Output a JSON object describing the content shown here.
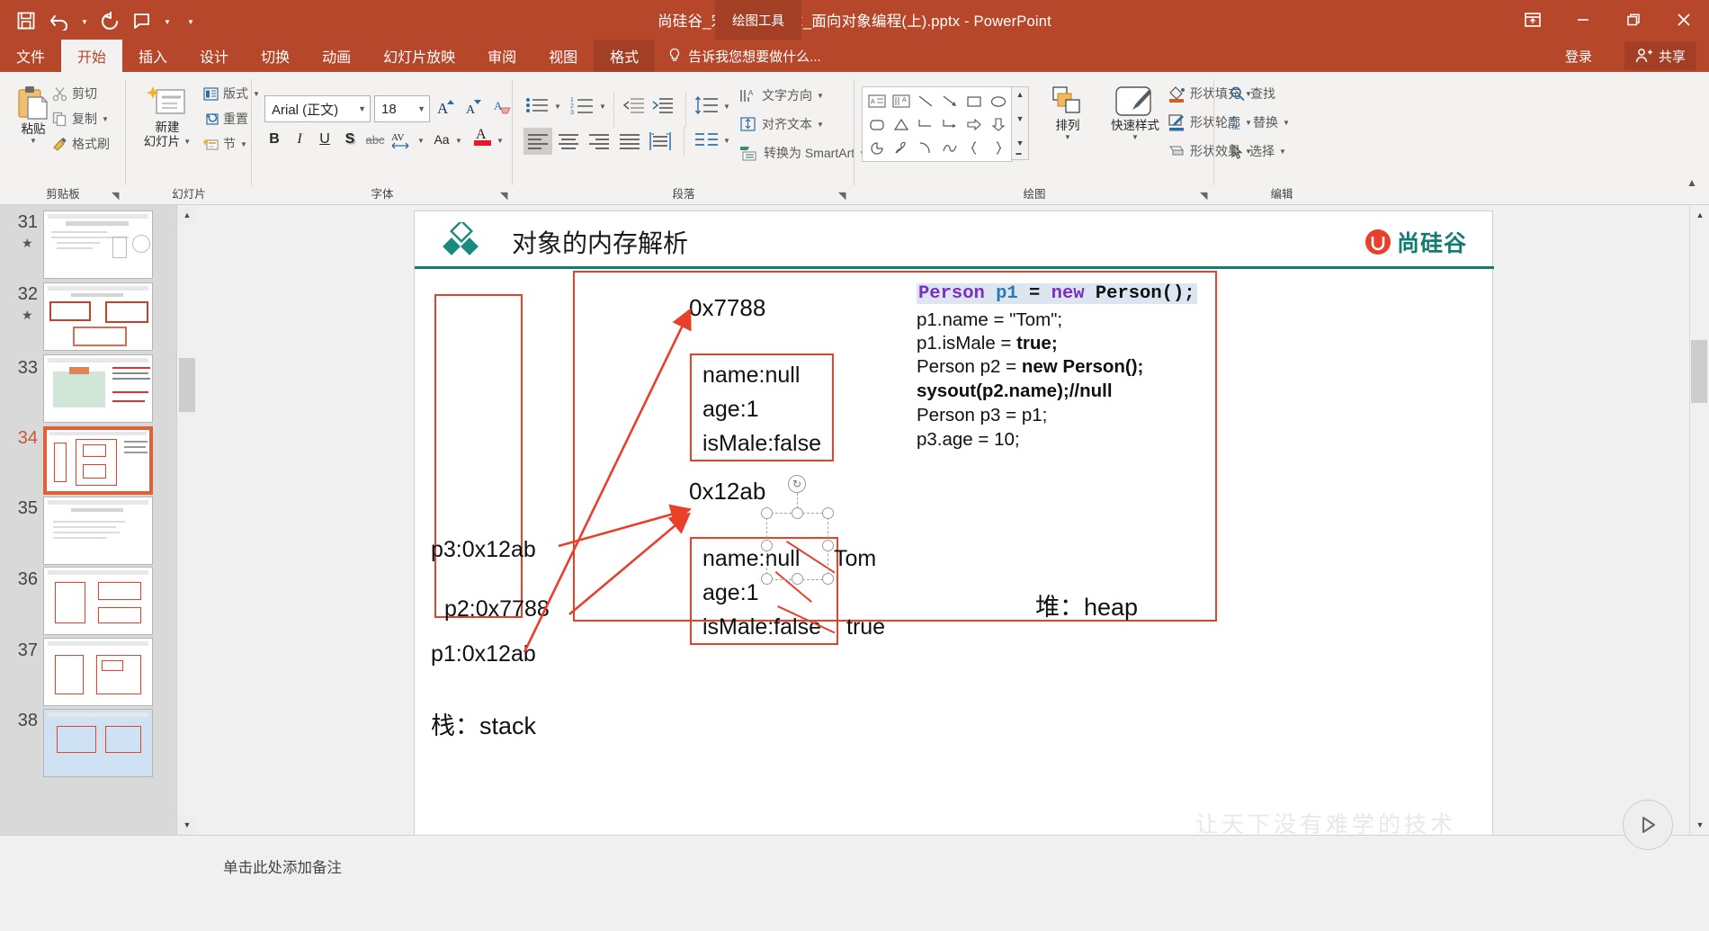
{
  "window": {
    "title": "尚硅谷_宋红康_第4章_面向对象编程(上).pptx - PowerPoint",
    "contextual_tab_group": "绘图工具",
    "signin": "登录",
    "share": "共享",
    "ribbon_display_icon": "ribbon-display-options-icon",
    "minimize_icon": "minimize-icon",
    "restore_icon": "restore-icon",
    "close_icon": "close-icon"
  },
  "qat": {
    "save": "save-icon",
    "undo": "undo-icon",
    "redo": "redo-icon",
    "start_from_beginning": "presentation-icon",
    "customize": "customize-qat-icon"
  },
  "tabs": [
    {
      "label": "文件",
      "active": false,
      "ctx": false
    },
    {
      "label": "开始",
      "active": true,
      "ctx": false
    },
    {
      "label": "插入",
      "active": false,
      "ctx": false
    },
    {
      "label": "设计",
      "active": false,
      "ctx": false
    },
    {
      "label": "切换",
      "active": false,
      "ctx": false
    },
    {
      "label": "动画",
      "active": false,
      "ctx": false
    },
    {
      "label": "幻灯片放映",
      "active": false,
      "ctx": false
    },
    {
      "label": "审阅",
      "active": false,
      "ctx": false
    },
    {
      "label": "视图",
      "active": false,
      "ctx": false
    },
    {
      "label": "格式",
      "active": false,
      "ctx": true
    }
  ],
  "tell_me": "告诉我您想要做什么...",
  "ribbon": {
    "groups": [
      {
        "label": "剪贴板"
      },
      {
        "label": "幻灯片"
      },
      {
        "label": "字体"
      },
      {
        "label": "段落"
      },
      {
        "label": "绘图"
      },
      {
        "label": "编辑"
      }
    ],
    "clipboard": {
      "paste": "粘贴",
      "cut": "剪切",
      "copy": "复制",
      "format_painter": "格式刷"
    },
    "slides": {
      "new_slide": "新建\n幻灯片",
      "new_slide_line1": "新建",
      "new_slide_line2": "幻灯片",
      "layout": "版式",
      "reset": "重置",
      "section": "节"
    },
    "font": {
      "font_name": "Arial (正文)",
      "font_size": "18",
      "bold": "B",
      "italic": "I",
      "underline": "U",
      "shadow": "S",
      "strikethrough": "abc",
      "char_spacing": "AV",
      "change_case": "Aa",
      "font_color": "A",
      "increase_size": "A",
      "decrease_size": "A",
      "clear_formatting": "clear-formatting-icon"
    },
    "paragraph": {
      "bullets": "bullets-icon",
      "numbering": "numbering-icon",
      "decrease_indent": "decrease-indent-icon",
      "increase_indent": "increase-indent-icon",
      "line_spacing": "line-spacing-icon",
      "align_left": "align-left-icon",
      "align_center": "align-center-icon",
      "align_right": "align-right-icon",
      "justify": "justify-icon",
      "columns": "columns-icon",
      "text_direction": "文字方向",
      "align_text": "对齐文本",
      "convert_smartart": "转换为 SmartArt"
    },
    "drawing": {
      "arrange": "排列",
      "quick_styles": "快速样式",
      "shape_fill": "形状填充",
      "shape_outline": "形状轮廓",
      "shape_effects": "形状效果"
    },
    "editing": {
      "find": "查找",
      "replace": "替换",
      "select": "选择"
    }
  },
  "thumbnails": [
    {
      "num": "31",
      "star": true,
      "selected": false
    },
    {
      "num": "32",
      "star": true,
      "selected": false
    },
    {
      "num": "33",
      "star": false,
      "selected": false
    },
    {
      "num": "34",
      "star": false,
      "selected": true
    },
    {
      "num": "35",
      "star": false,
      "selected": false
    },
    {
      "num": "36",
      "star": false,
      "selected": false
    },
    {
      "num": "37",
      "star": false,
      "selected": false
    },
    {
      "num": "38",
      "star": false,
      "selected": false
    }
  ],
  "slide": {
    "title": "对象的内存解析",
    "brand": "尚硅谷",
    "watermark": "让天下没有难学的技术",
    "stack_label": "栈：stack",
    "heap_label": "堆：heap",
    "stack_entries": [
      "p3:0x12ab",
      "p2:0x7788",
      "p1:0x12ab"
    ],
    "object1": {
      "address": "0x7788",
      "fields": [
        "name:null",
        "age:1",
        "isMale:false"
      ]
    },
    "object2": {
      "address": "0x12ab",
      "fields": [
        "name:null",
        "age:1",
        "isMale:false"
      ],
      "annotations": [
        "Tom",
        "true"
      ]
    },
    "code": [
      "Person p1 = new Person();",
      "p1.name = \"Tom\";",
      "p1.isMale = true;",
      "Person p2 = new Person();",
      "sysout(p2.name);//null",
      "Person p3 = p1;",
      "p3.age = 10;"
    ]
  },
  "notes": {
    "placeholder": "单击此处添加备注"
  }
}
